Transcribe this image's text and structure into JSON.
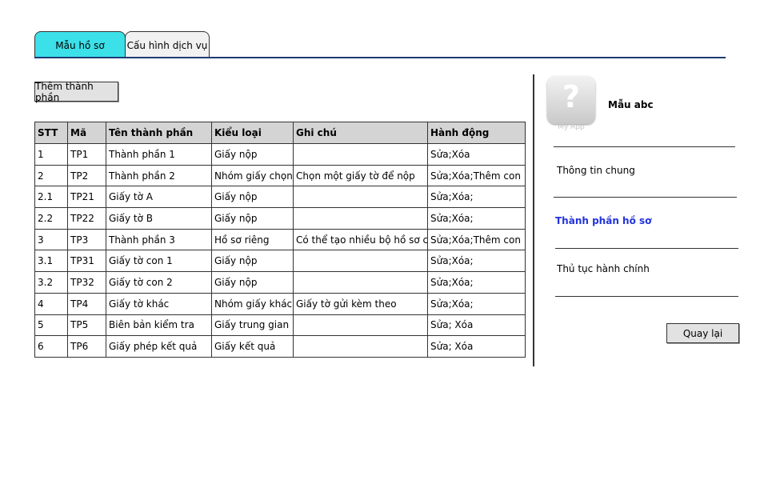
{
  "tabs": [
    {
      "label": "Mẫu hồ sơ",
      "active": true
    },
    {
      "label": "Cấu hình dịch vụ",
      "active": false
    }
  ],
  "toolbar": {
    "add_label": "Thêm thành phần"
  },
  "table": {
    "headers": [
      "STT",
      "Mã",
      "Tên thành phần",
      "Kiểu loại",
      "Ghi chú",
      "Hành động"
    ],
    "rows": [
      [
        "1",
        "TP1",
        "Thành phần 1",
        "Giấy nộp",
        "",
        "Sửa;Xóa"
      ],
      [
        "2",
        "TP2",
        "Thành phần 2",
        "Nhóm giấy chọn",
        "Chọn một giấy tờ để nộp",
        "Sửa;Xóa;Thêm con"
      ],
      [
        "2.1",
        "TP21",
        "Giấy tờ A",
        "Giấy nộp",
        "",
        "Sửa;Xóa;"
      ],
      [
        "2.2",
        "TP22",
        "Giấy tờ B",
        "Giấy nộp",
        "",
        "Sửa;Xóa;"
      ],
      [
        "3",
        "TP3",
        "Thành phần 3",
        "Hồ sơ riêng",
        "Có thể tạo nhiều bộ hồ sơ con",
        "Sửa;Xóa;Thêm con"
      ],
      [
        "3.1",
        "TP31",
        "Giấy tờ con 1",
        "Giấy nộp",
        "",
        "Sửa;Xóa;"
      ],
      [
        "3.2",
        "TP32",
        "Giấy tờ con 2",
        "Giấy nộp",
        "",
        "Sửa;Xóa;"
      ],
      [
        "4",
        "TP4",
        "Giấy tờ khác",
        "Nhóm giấy khác",
        "Giấy tờ gửi kèm theo",
        "Sửa;Xóa;"
      ],
      [
        "5",
        "TP5",
        "Biên bản kiểm tra",
        "Giấy trung gian",
        "",
        "Sửa; Xóa"
      ],
      [
        "6",
        "TP6",
        "Giấy phép kết quả",
        "Giấy kết quả",
        "",
        "Sửa; Xóa"
      ]
    ]
  },
  "profile": {
    "icon": "question-app-icon",
    "icon_caption": "My App",
    "title": "Mẫu abc"
  },
  "side_nav": [
    {
      "label": "Thông tin chung",
      "active": false
    },
    {
      "label": "Thành phần hồ sơ",
      "active": true
    },
    {
      "label": "Thủ tục hành chính",
      "active": false
    }
  ],
  "back_label": "Quay lại",
  "colors": {
    "active_tab": "#3ce0e8",
    "active_nav": "#2233dd",
    "tab_line": "#1f3a73"
  }
}
